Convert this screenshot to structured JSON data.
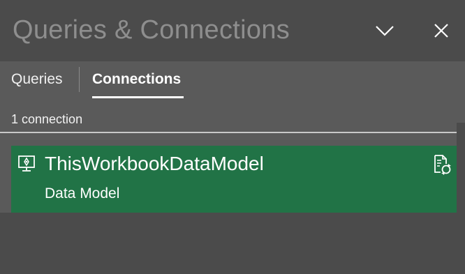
{
  "pane": {
    "title": "Queries & Connections",
    "collapse_icon": "chevron-down-icon",
    "close_icon": "close-icon"
  },
  "tabs": [
    {
      "label": "Queries",
      "selected": false
    },
    {
      "label": "Connections",
      "selected": true
    }
  ],
  "connections": {
    "count_label": "1 connection",
    "items": [
      {
        "name": "ThisWorkbookDataModel",
        "subtitle": "Data Model",
        "icon": "data-model-connection-icon",
        "action_icon": "refresh-document-icon"
      }
    ]
  },
  "colors": {
    "pane_background": "#4b4b4b",
    "tab_area_background": "#5a5a5a",
    "selected_item_background": "#217346",
    "title_text": "#8e8e8e"
  }
}
